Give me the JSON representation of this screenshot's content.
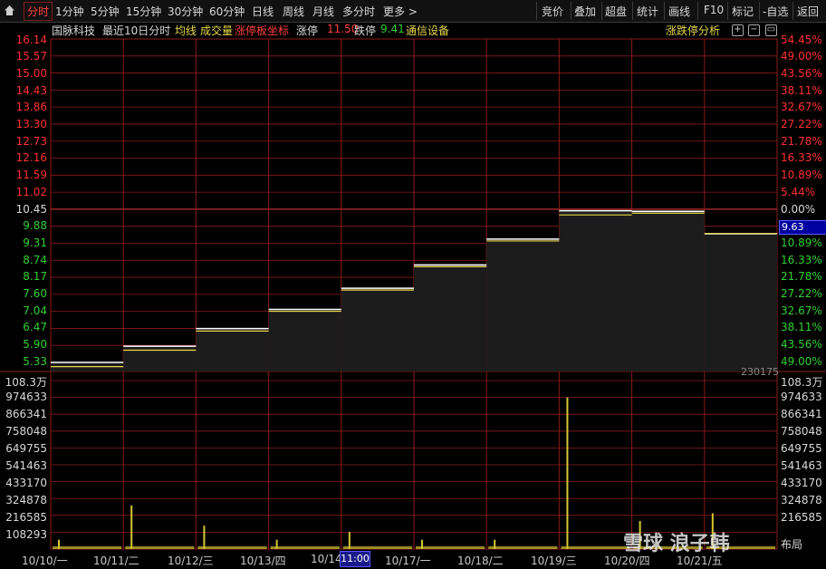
{
  "toolbar": {
    "tabs": [
      "分时",
      "1分钟",
      "5分钟",
      "15分钟",
      "30分钟",
      "60分钟",
      "日线",
      "周线",
      "月线",
      "多分时",
      "更多 >"
    ],
    "right_buttons": [
      "竞价",
      "叠加",
      "超盘",
      "统计",
      "画线",
      "F10",
      "标记",
      "-自选",
      "返回"
    ]
  },
  "info": {
    "stock_name": "国脉科技",
    "period": "最近10日分时",
    "avg_line": "均线",
    "volume": "成交量",
    "limit_axis": "涨停板坐标",
    "limit_up_label": "涨停",
    "limit_up_value": "11.50",
    "limit_down_label": "跌停",
    "limit_down_value": "9.41",
    "sector": "通信设备",
    "analysis": "涨跌停分析"
  },
  "price_axis": [
    "16.14",
    "15.57",
    "15.00",
    "14.43",
    "13.86",
    "13.30",
    "12.73",
    "12.16",
    "11.59",
    "11.02",
    "10.45",
    "9.88",
    "9.31",
    "8.74",
    "8.17",
    "7.60",
    "7.04",
    "6.47",
    "5.90",
    "5.33"
  ],
  "pct_axis": [
    "54.45%",
    "49.00%",
    "43.56%",
    "38.11%",
    "32.67%",
    "27.22%",
    "21.78%",
    "16.33%",
    "10.89%",
    "5.44%",
    "0.00%",
    "5.44%",
    "10.89%",
    "16.33%",
    "21.78%",
    "27.22%",
    "32.67%",
    "38.11%",
    "43.56%",
    "49.00%"
  ],
  "volume_axis": [
    "108.3万",
    "974633",
    "866341",
    "758048",
    "649755",
    "541463",
    "433170",
    "324878",
    "216585",
    "108293"
  ],
  "current_price": "9.63",
  "current_volume": "230175",
  "time_badge": "11:00",
  "date_labels": [
    "10/10/一",
    "10/11/二",
    "10/12/三",
    "10/13/四",
    "10/14/",
    "10/17/一",
    "10/18/二",
    "10/19/三",
    "10/20/四",
    "10/21/五"
  ],
  "watermark": "雪球 浪子韩",
  "colors": {
    "grid": "#8b1a1a",
    "price_line": "#ffffff",
    "avg_line": "#e6d84a",
    "volume": "#d4c830",
    "up": "#ff3030",
    "down": "#30d030"
  },
  "chart_data": {
    "type": "line",
    "days": [
      "10/10",
      "10/11",
      "10/12",
      "10/13",
      "10/14",
      "10/17",
      "10/18",
      "10/19",
      "10/20",
      "10/21"
    ],
    "series": [
      {
        "values": [
          5.33,
          5.87,
          6.46,
          7.1,
          7.81,
          8.59,
          9.45,
          10.4,
          10.38,
          9.63
        ]
      },
      {
        "values": [
          5.25,
          5.8,
          6.44,
          7.1,
          7.81,
          8.59,
          9.45,
          10.32,
          10.38,
          9.7
        ]
      }
    ],
    "daily_volume_peak": [
      60000,
      280000,
      150000,
      60000,
      110000,
      60000,
      60000,
      974633,
      180000,
      230175
    ],
    "ylim": [
      5.33,
      16.14
    ],
    "volume_ylim": [
      0,
      1083000
    ]
  }
}
